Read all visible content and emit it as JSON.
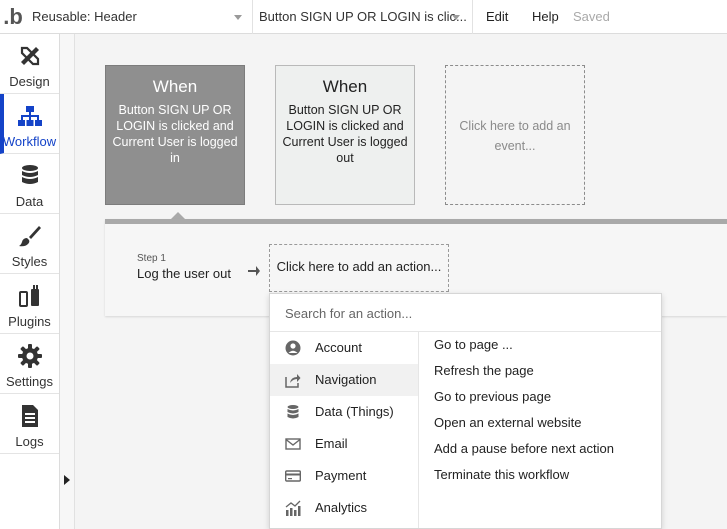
{
  "topbar": {
    "logo": ".b",
    "page_selector": "Reusable: Header",
    "event_selector": "Button SIGN UP OR LOGIN is clic...",
    "edit_label": "Edit",
    "help_label": "Help",
    "saved_label": "Saved"
  },
  "sidebar": {
    "items": [
      {
        "label": "Design",
        "icon": "design-icon"
      },
      {
        "label": "Workflow",
        "icon": "workflow-icon",
        "active": true
      },
      {
        "label": "Data",
        "icon": "database-icon"
      },
      {
        "label": "Styles",
        "icon": "brush-icon"
      },
      {
        "label": "Plugins",
        "icon": "plug-icon"
      },
      {
        "label": "Settings",
        "icon": "gear-icon"
      },
      {
        "label": "Logs",
        "icon": "document-icon"
      }
    ],
    "accent": "#1443c8"
  },
  "events": [
    {
      "when": "When",
      "description": "Button SIGN UP OR LOGIN is clicked and Current User is logged in",
      "state": "active"
    },
    {
      "when": "When",
      "description": "Button SIGN UP OR LOGIN is clicked and Current User is logged out",
      "state": "idle"
    },
    {
      "description": "Click here to add an event...",
      "state": "add"
    }
  ],
  "workflow": {
    "step_number": "Step 1",
    "step_title": "Log the user out",
    "add_action_label": "Click here to add an action..."
  },
  "action_menu": {
    "search_placeholder": "Search for an action...",
    "categories": [
      {
        "label": "Account",
        "icon": "account-icon"
      },
      {
        "label": "Navigation",
        "icon": "navigation-icon",
        "highlighted": true
      },
      {
        "label": "Data (Things)",
        "icon": "database-icon"
      },
      {
        "label": "Email",
        "icon": "email-icon"
      },
      {
        "label": "Payment",
        "icon": "payment-icon"
      },
      {
        "label": "Analytics",
        "icon": "analytics-icon"
      }
    ],
    "actions": [
      "Go to page ...",
      "Refresh the page",
      "Go to previous page",
      "Open an external website",
      "Add a pause before next action",
      "Terminate this workflow"
    ]
  }
}
